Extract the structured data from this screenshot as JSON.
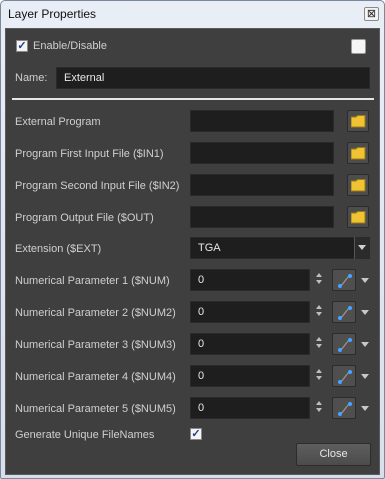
{
  "window": {
    "title": "Layer Properties",
    "close_glyph": "⊠"
  },
  "enable": {
    "label": "Enable/Disable",
    "checked": true
  },
  "name": {
    "label": "Name:",
    "value": "External"
  },
  "files": [
    {
      "label": "External Program",
      "value": ""
    },
    {
      "label": "Program First Input File ($IN1)",
      "value": ""
    },
    {
      "label": "Program Second Input File ($IN2)",
      "value": ""
    },
    {
      "label": "Program Output File ($OUT)",
      "value": ""
    }
  ],
  "extension": {
    "label": "Extension ($EXT)",
    "value": "TGA"
  },
  "params": [
    {
      "label": "Numerical Parameter 1 ($NUM)",
      "value": "0"
    },
    {
      "label": "Numerical Parameter 2 ($NUM2)",
      "value": "0"
    },
    {
      "label": "Numerical Parameter 3 ($NUM3)",
      "value": "0"
    },
    {
      "label": "Numerical Parameter 4 ($NUM4)",
      "value": "0"
    },
    {
      "label": "Numerical Parameter 5 ($NUM5)",
      "value": "0"
    }
  ],
  "unique": {
    "label": "Generate Unique FileNames",
    "checked": true
  },
  "buttons": {
    "close": "Close"
  },
  "icons": {
    "folder": "folder-icon",
    "function": "function-curve-icon",
    "check": "✓"
  },
  "colors": {
    "panel": "#3f3f3f",
    "field": "#1e1e1e",
    "folder": "#f1c232"
  }
}
